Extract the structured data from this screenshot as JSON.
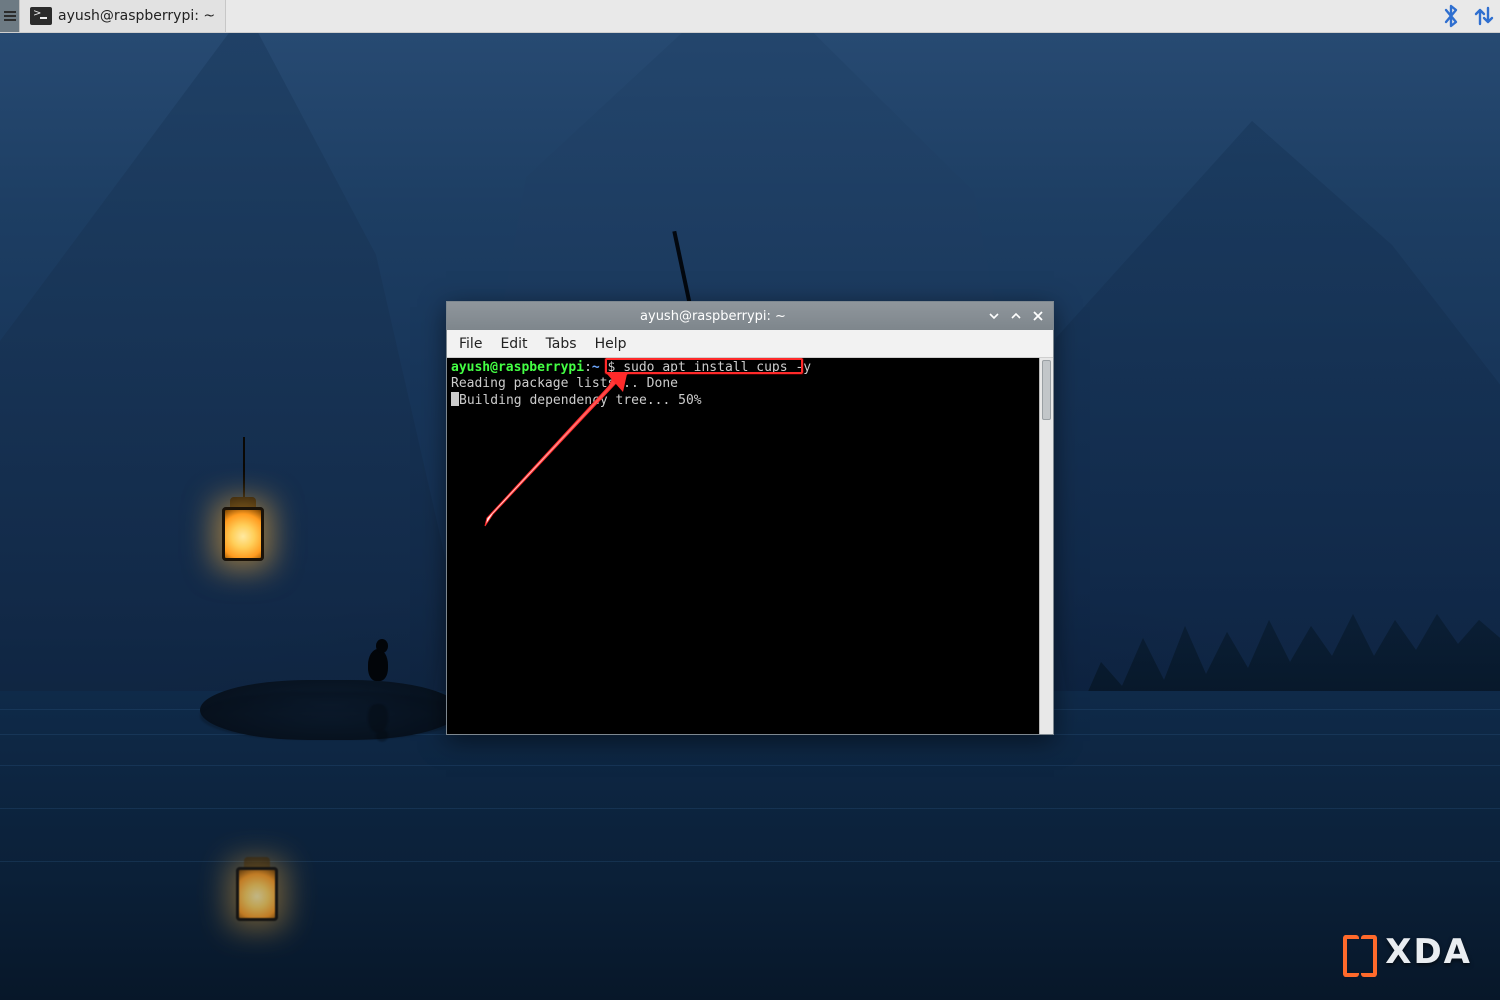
{
  "taskbar": {
    "window_title": "ayush@raspberrypi: ~",
    "tray": {
      "bluetooth": "bluetooth-icon",
      "network": "network-updown-icon"
    }
  },
  "terminal_window": {
    "title": "ayush@raspberrypi: ~",
    "menu": {
      "file": "File",
      "edit": "Edit",
      "tabs": "Tabs",
      "help": "Help"
    },
    "prompt": {
      "user_host": "ayush@raspberrypi",
      "separator": ":",
      "path": "~",
      "dollar": " $ "
    },
    "command": "sudo apt install cups -y",
    "output_lines": [
      "Reading package lists... Done",
      "Building dependency tree... 50%"
    ]
  },
  "watermark": {
    "text": "XDA"
  }
}
